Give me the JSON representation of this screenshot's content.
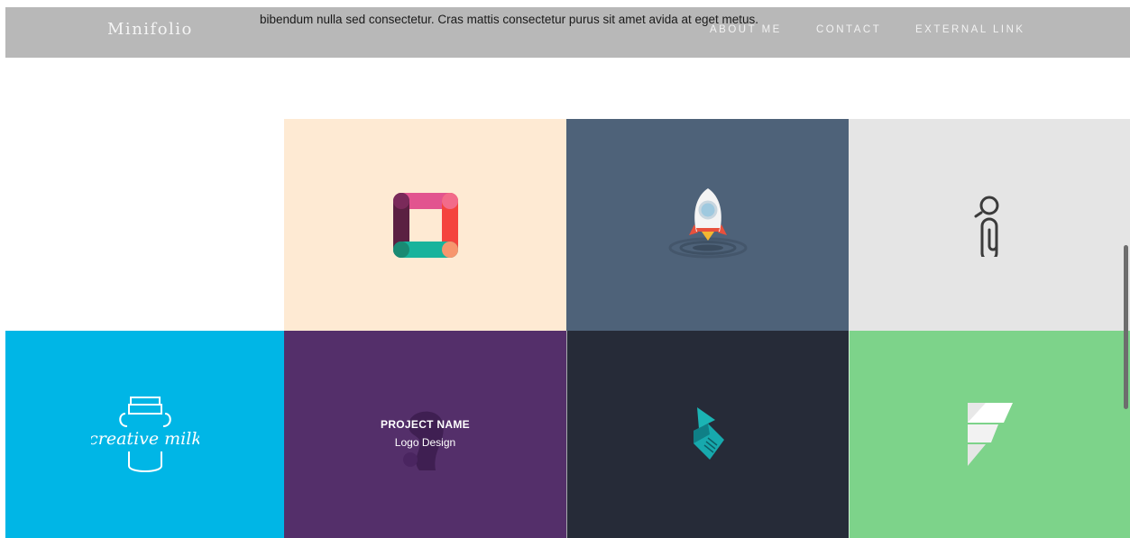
{
  "top_overflow_text": "",
  "navbar": {
    "brand": "Minifolio",
    "overlay_text": "bibendum nulla sed consectetur. Cras mattis consectetur purus sit amet avida at eget metus.",
    "links": [
      {
        "label": "ABOUT ME"
      },
      {
        "label": "CONTACT"
      },
      {
        "label": "EXTERNAL LINK"
      }
    ]
  },
  "portfolio": {
    "tiles": [
      {
        "icon": "square-ring-logo-icon",
        "color": "#feead3"
      },
      {
        "icon": "rocket-icon",
        "color": "#4e6279"
      },
      {
        "icon": "paperclip-person-icon",
        "color": "#e5e5e5"
      },
      {
        "icon": "creative-milk-logo-icon",
        "label": "creative milk",
        "color": "#00b6e6"
      },
      {
        "icon": "squirrel-logo-icon",
        "color": "#542f6a",
        "hover": {
          "title": "PROJECT NAME",
          "subtitle": "Logo Design"
        }
      },
      {
        "icon": "lightning-k-logo-icon",
        "color": "#262b38"
      },
      {
        "icon": "f-logo-icon",
        "color": "#7dd38a"
      }
    ]
  },
  "colors": {
    "navbar_bg": "#b8b8b8",
    "accent_teal": "#17b3b5"
  }
}
